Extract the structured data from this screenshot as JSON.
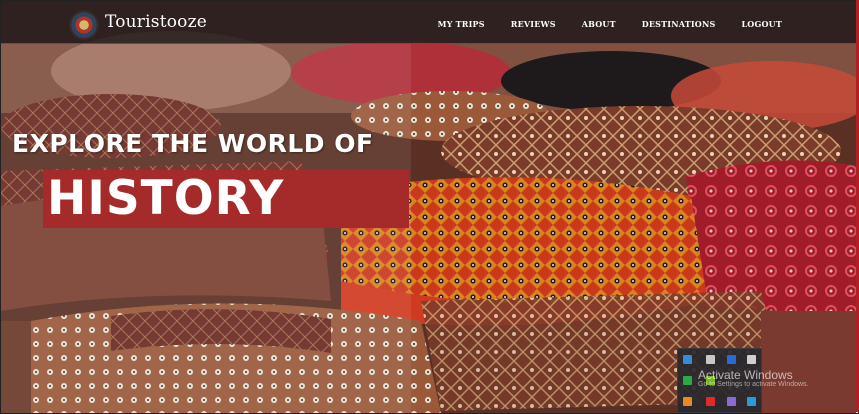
{
  "header": {
    "brand": "Touristooze",
    "nav": [
      {
        "label": "MY TRIPS"
      },
      {
        "label": "REVIEWS"
      },
      {
        "label": "ABOUT"
      },
      {
        "label": "DESTINATIONS"
      },
      {
        "label": "LOGOUT"
      }
    ]
  },
  "hero": {
    "headline": "EXPLORE THE WORLD OF",
    "highlight": "HISTORY",
    "accent_color": "#a52a2a"
  },
  "system": {
    "watermark_title": "Activate Windows",
    "watermark_subtitle": "Go to Settings to activate Windows.",
    "tray_icons": [
      "windows-defender-icon",
      "notes-icon",
      "bluetooth-icon",
      "network-icon",
      "app-icon",
      "nvidia-icon",
      "mail-icon",
      "shield-icon",
      "pen-icon",
      "skype-icon"
    ]
  }
}
